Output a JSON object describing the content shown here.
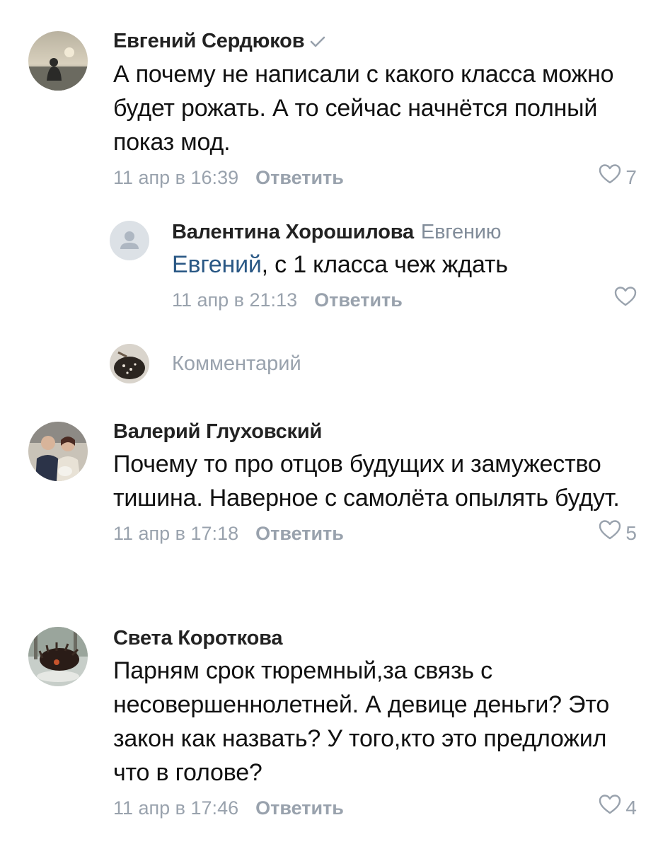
{
  "comments": [
    {
      "author": "Евгений Сердюков",
      "verified": true,
      "text": "А почему не написали с какого класса можно будет рожать. А то сейчас начнётся полный показ мод.",
      "date": "11 апр в 16:39",
      "reply_label": "Ответить",
      "likes": "7"
    },
    {
      "author": "Валентина Хорошилова",
      "reply_to": "Евгению",
      "mention": "Евгений",
      "text": ", с 1 класса чеж ждать",
      "date": "11 апр в 21:13",
      "reply_label": "Ответить"
    },
    {
      "author": "Валерий Глуховский",
      "text": "Почему то про отцов будущих и замужество тишина. Наверное с самолёта опылять будут.",
      "date": "11 апр в 17:18",
      "reply_label": "Ответить",
      "likes": "5"
    },
    {
      "author": "Света Короткова",
      "text": "Парням срок тюремный,за связь с несовершеннолетней. А девице деньги? Это закон как назвать? У того,кто это предложил что в голове?",
      "date": "11 апр в 17:46",
      "reply_label": "Ответить",
      "likes": "4"
    }
  ],
  "composer": {
    "placeholder": "Комментарий"
  },
  "colors": {
    "secondary": "#99a2ad",
    "link": "#2a5885",
    "verified": "#99a2ad",
    "placeholder_avatar": "#dce1e6"
  }
}
